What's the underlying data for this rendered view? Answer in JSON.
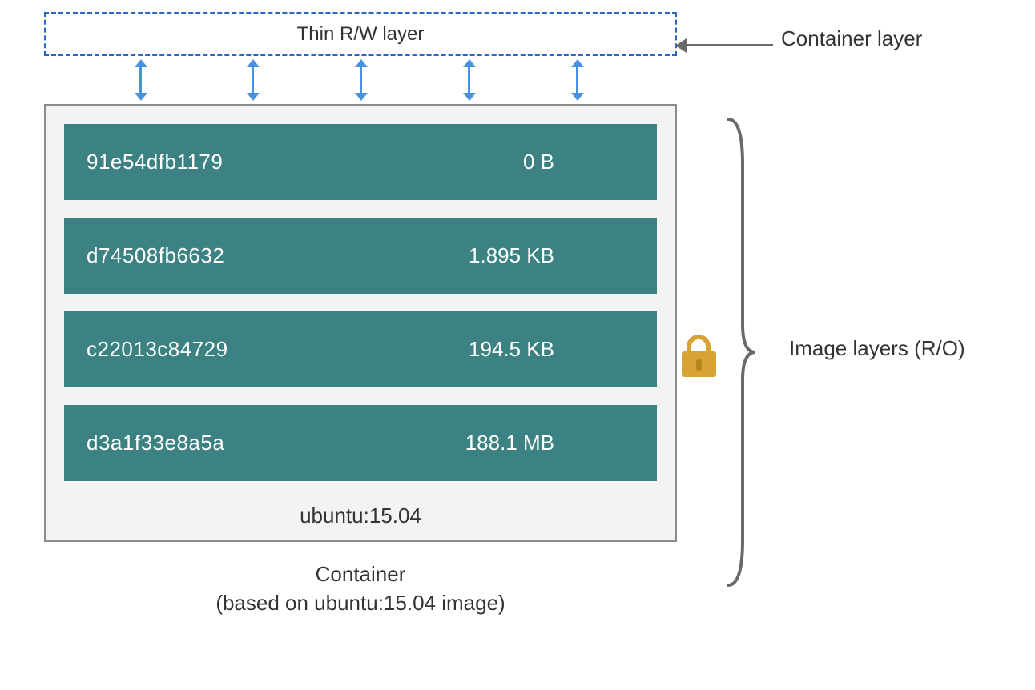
{
  "rw": {
    "label": "Thin R/W layer"
  },
  "labels": {
    "container_layer": "Container layer",
    "image_layers": "Image layers (R/O)"
  },
  "image": {
    "tag": "ubuntu:15.04",
    "layers": [
      {
        "hash": "91e54dfb1179",
        "size": "0 B"
      },
      {
        "hash": "d74508fb6632",
        "size": "1.895 KB"
      },
      {
        "hash": "c22013c84729",
        "size": "194.5 KB"
      },
      {
        "hash": "d3a1f33e8a5a",
        "size": "188.1 MB"
      }
    ]
  },
  "caption": {
    "line1": "Container",
    "line2": "(based on ubuntu:15.04 image)"
  },
  "colors": {
    "layer_bg": "#3d8282",
    "dash_border": "#2b66c6",
    "arrow_blue": "#4a90e2",
    "arrow_gray": "#696969",
    "lock": "#d9a334"
  }
}
